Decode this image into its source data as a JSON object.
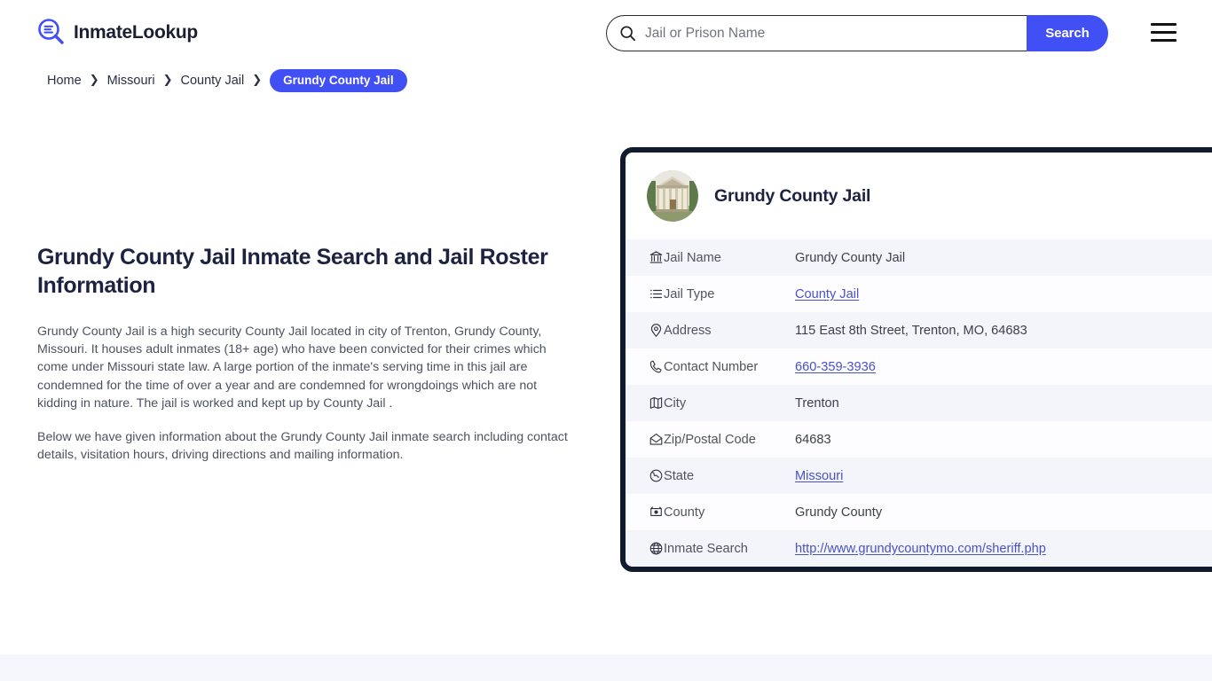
{
  "header": {
    "brand_name": "InmateLookup",
    "logo_icon": "magnifier-lines-icon",
    "search": {
      "placeholder": "Jail or Prison Name",
      "value": "",
      "icon": "search-icon",
      "button_label": "Search"
    },
    "menu_icon": "hamburger-menu-icon",
    "accent_color": "#4050f4"
  },
  "breadcrumb": {
    "separator": "❯",
    "items": [
      {
        "label": "Home",
        "current": false
      },
      {
        "label": "Missouri",
        "current": false
      },
      {
        "label": "County Jail",
        "current": false
      },
      {
        "label": "Grundy County Jail",
        "current": true
      }
    ]
  },
  "main": {
    "title": "Grundy County Jail Inmate Search and Jail Roster Information",
    "paragraphs": [
      "Grundy County Jail is a high security County Jail located in city of Trenton, Grundy County, Missouri. It houses adult inmates (18+ age) who have been convicted for their crimes which come under Missouri state law. A large portion of the inmate's serving time in this jail are condemned for the time of over a year and are condemned for wrongdoings which are not kidding in nature. The jail is worked and kept up by County Jail .",
      "Below we have given information about the Grundy County Jail inmate search including contact details, visitation hours, driving directions and mailing information."
    ]
  },
  "info_card": {
    "title": "Grundy County Jail",
    "avatar_icon": "courthouse-photo",
    "border_color": "#111a2e",
    "link_color": "#4a51c6",
    "rows": [
      {
        "icon": "bank-icon",
        "label": "Jail Name",
        "value": "Grundy County Jail",
        "is_link": false
      },
      {
        "icon": "list-icon",
        "label": "Jail Type",
        "value": "County Jail",
        "is_link": true
      },
      {
        "icon": "map-pin-icon",
        "label": "Address",
        "value": "115 East 8th Street, Trenton, MO, 64683",
        "is_link": false
      },
      {
        "icon": "phone-icon",
        "label": "Contact Number",
        "value": "660-359-3936",
        "is_link": true
      },
      {
        "icon": "map-icon",
        "label": "City",
        "value": "Trenton",
        "is_link": false
      },
      {
        "icon": "envelope-icon",
        "label": "Zip/Postal Code",
        "value": "64683",
        "is_link": false
      },
      {
        "icon": "globe-state-icon",
        "label": "State",
        "value": "Missouri",
        "is_link": true
      },
      {
        "icon": "county-icon",
        "label": "County",
        "value": "Grundy County",
        "is_link": false
      },
      {
        "icon": "globe-icon",
        "label": "Inmate Search",
        "value": "http://www.grundycountymo.com/sheriff.php",
        "is_link": true
      }
    ]
  }
}
